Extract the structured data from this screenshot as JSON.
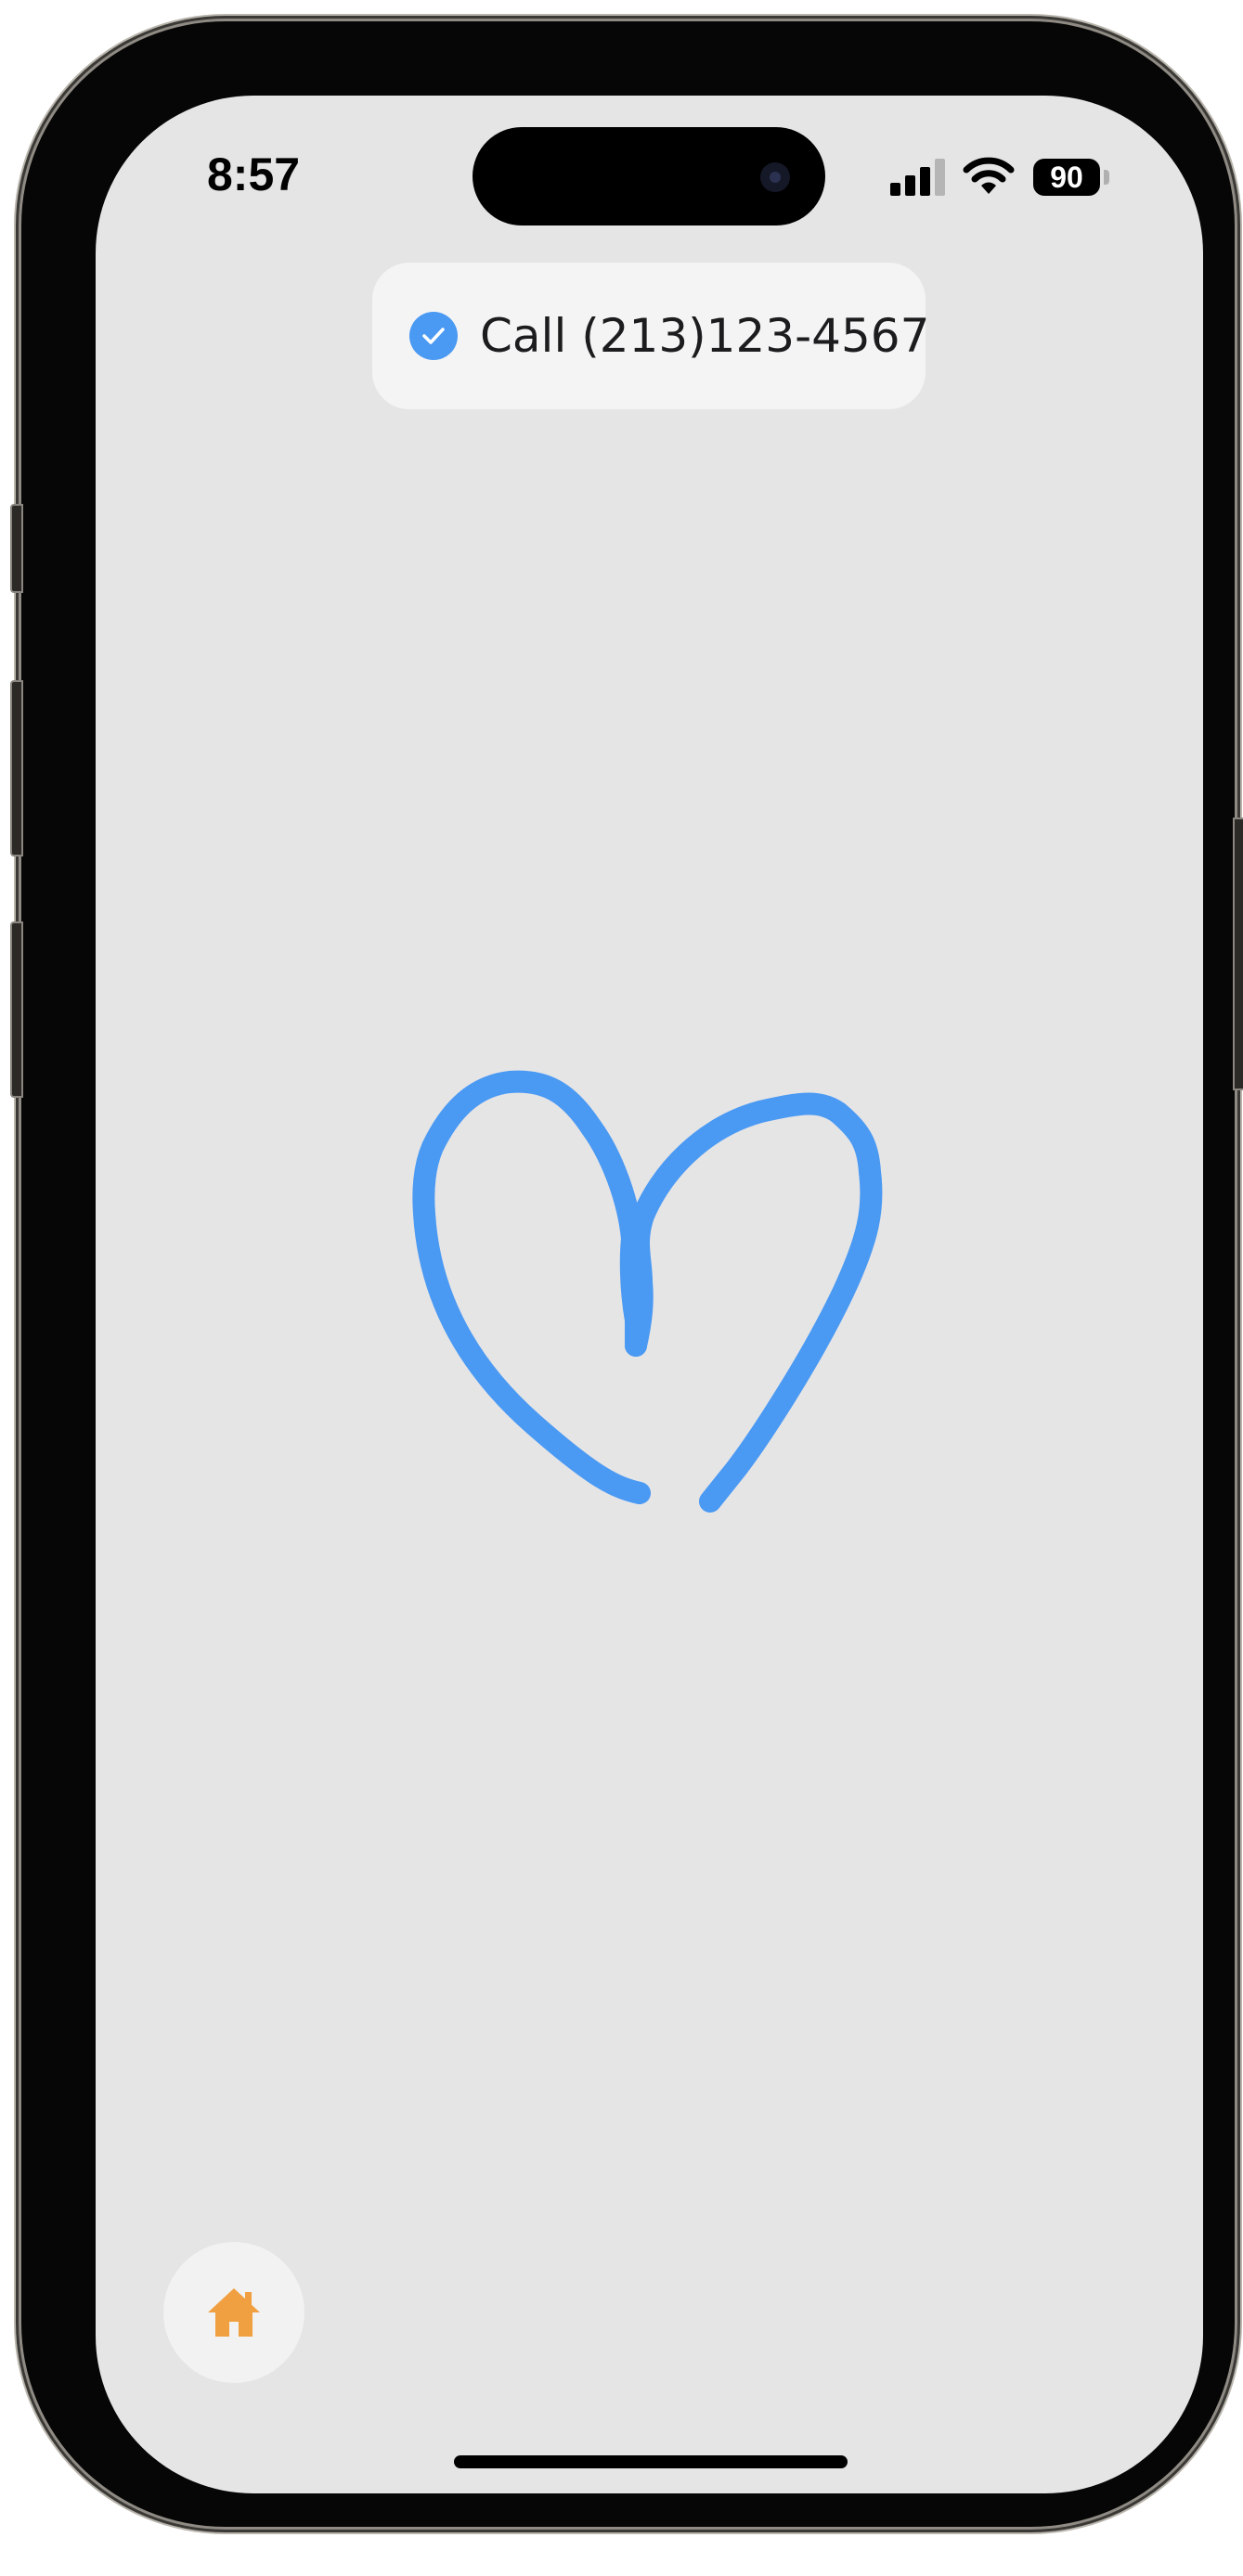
{
  "status_bar": {
    "time": "8:57",
    "battery_level": "90",
    "signal_bars_active": 3,
    "signal_bars_total": 4,
    "wifi_icon": "wifi-icon",
    "signal_icon": "cellular-signal-icon"
  },
  "toast": {
    "icon": "check-circle-icon",
    "text": "Call (213)123-4567"
  },
  "drawing": {
    "shape": "heart",
    "stroke_color": "#4a99f3"
  },
  "home_button": {
    "icon": "house-icon",
    "color": "#f0a040"
  },
  "colors": {
    "screen_background": "#e5e5e6",
    "accent": "#4a99f3"
  }
}
